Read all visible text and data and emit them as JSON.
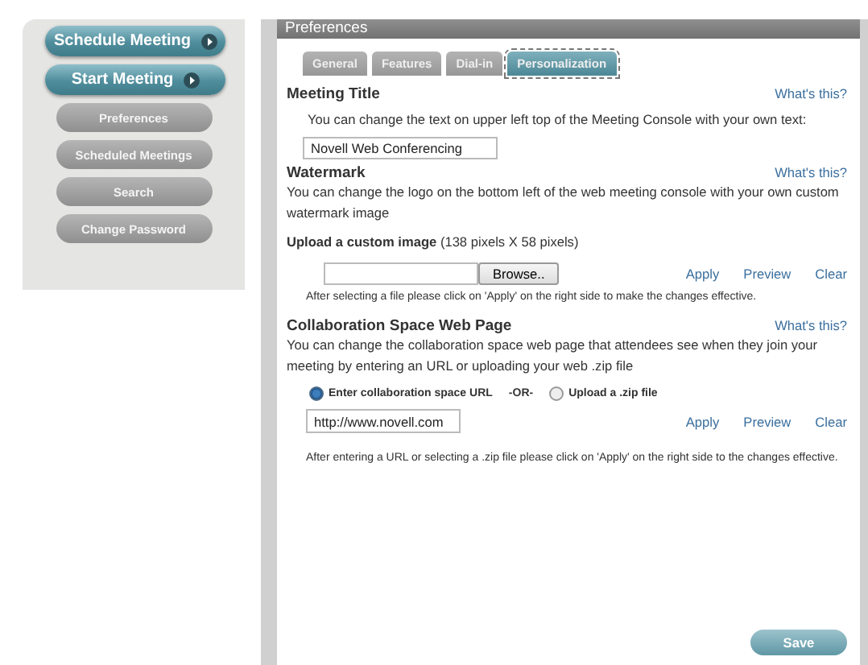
{
  "sidebar": {
    "items": [
      {
        "label": "Schedule Meeting",
        "kind": "primary"
      },
      {
        "label": "Start Meeting",
        "kind": "primary"
      },
      {
        "label": "Preferences",
        "kind": "secondary"
      },
      {
        "label": "Scheduled Meetings",
        "kind": "secondary"
      },
      {
        "label": "Search",
        "kind": "secondary"
      },
      {
        "label": "Change Password",
        "kind": "secondary"
      }
    ]
  },
  "panel": {
    "title": "Preferences",
    "tabs": [
      {
        "label": "General",
        "selected": false
      },
      {
        "label": "Features",
        "selected": false
      },
      {
        "label": "Dial-in",
        "selected": false
      },
      {
        "label": "Personalization",
        "selected": true
      }
    ],
    "meeting_title": {
      "heading": "Meeting Title",
      "help_link": "What's this?",
      "description": "You can change the text on upper left top of the Meeting Console with your own text:",
      "value": "Novell Web Conferencing"
    },
    "watermark": {
      "heading": "Watermark",
      "help_link": "What's this?",
      "description": "You can change the logo on the bottom left of the web meeting console with your own custom watermark image",
      "upload_label": "**Upload a custom image** (138 pixels X 58 pixels)",
      "browse_button": "Browse..",
      "actions": [
        "Apply",
        "Preview",
        "Clear"
      ],
      "note": "After selecting a file please click on 'Apply' on the right side to make the changes effective."
    },
    "collaboration": {
      "heading": "Collaboration Space Web Page",
      "help_link": "What's this?",
      "description": "You can change the collaboration space web page that attendees see when they join your meeting by entering an URL or uploading your web .zip file",
      "options": [
        {
          "label": "Enter collaboration space URL",
          "selected": true
        },
        {
          "label": "Upload a .zip file",
          "selected": false
        }
      ],
      "separator": "-OR-",
      "url_value": "http://www.novell.com",
      "actions": [
        "Apply",
        "Preview",
        "Clear"
      ],
      "note": "After entering a URL or selecting a .zip file please click on 'Apply' on the right side to the changes effective."
    },
    "save_button": "Save"
  }
}
